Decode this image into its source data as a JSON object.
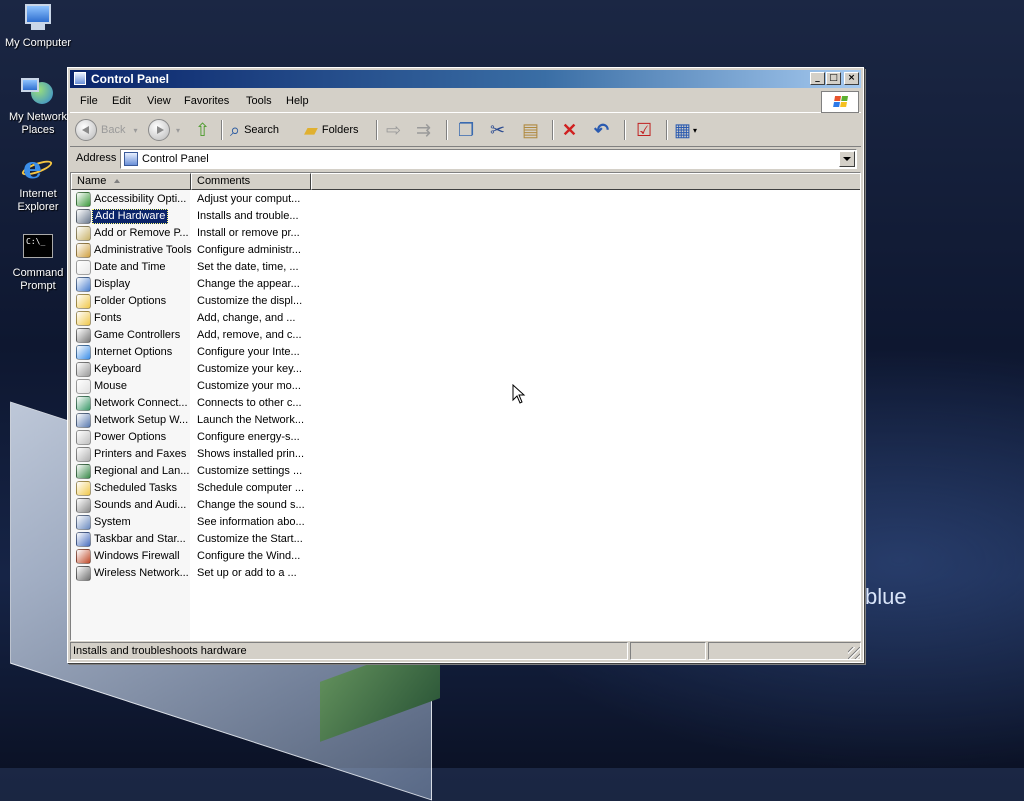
{
  "desktop": {
    "icons": [
      {
        "label": "My Computer"
      },
      {
        "label": "My Network Places"
      },
      {
        "label": "Internet Explorer"
      },
      {
        "label": "Command Prompt"
      }
    ],
    "brand_text": "blue"
  },
  "window": {
    "title": "Control Panel",
    "controls": {
      "minimize": "_",
      "maximize": "□",
      "close": "×"
    },
    "menu": [
      "File",
      "Edit",
      "View",
      "Favorites",
      "Tools",
      "Help"
    ],
    "toolbar": {
      "back_label": "Back",
      "search_label": "Search",
      "folders_label": "Folders"
    },
    "address": {
      "label": "Address",
      "value": "Control Panel"
    },
    "columns": {
      "name": "Name",
      "comments": "Comments"
    },
    "items": [
      {
        "name": "Accessibility Opti...",
        "comment": "Adjust your comput...",
        "icon": "accessibility-icon",
        "color": "#3c9a3c"
      },
      {
        "name": "Add Hardware",
        "comment": "Installs and trouble...",
        "icon": "add-hardware-icon",
        "color": "#6b7a8f"
      },
      {
        "name": "Add or Remove P...",
        "comment": "Install or remove pr...",
        "icon": "add-remove-programs-icon",
        "color": "#c9b36a"
      },
      {
        "name": "Administrative Tools",
        "comment": "Configure administr...",
        "icon": "administrative-tools-icon",
        "color": "#d0a040"
      },
      {
        "name": "Date and Time",
        "comment": "Set the date, time, ...",
        "icon": "clock-icon",
        "color": "#e8e8e8"
      },
      {
        "name": "Display",
        "comment": "Change the appear...",
        "icon": "display-icon",
        "color": "#4a7fcf"
      },
      {
        "name": "Folder Options",
        "comment": "Customize the displ...",
        "icon": "folder-options-icon",
        "color": "#f0c84a"
      },
      {
        "name": "Fonts",
        "comment": "Add, change, and ...",
        "icon": "fonts-folder-icon",
        "color": "#f0c84a"
      },
      {
        "name": "Game Controllers",
        "comment": "Add, remove, and c...",
        "icon": "game-controller-icon",
        "color": "#7a7a7a"
      },
      {
        "name": "Internet Options",
        "comment": "Configure your Inte...",
        "icon": "internet-options-icon",
        "color": "#3b8ee8"
      },
      {
        "name": "Keyboard",
        "comment": "Customize your key...",
        "icon": "keyboard-icon",
        "color": "#9a9a9a"
      },
      {
        "name": "Mouse",
        "comment": "Customize your mo...",
        "icon": "mouse-icon",
        "color": "#e0e0e0"
      },
      {
        "name": "Network Connect...",
        "comment": "Connects to other c...",
        "icon": "network-connections-icon",
        "color": "#3c9a6a"
      },
      {
        "name": "Network Setup W...",
        "comment": "Launch the Network...",
        "icon": "network-setup-icon",
        "color": "#5a7ab0"
      },
      {
        "name": "Power Options",
        "comment": "Configure energy-s...",
        "icon": "power-options-icon",
        "color": "#c0c0c0"
      },
      {
        "name": "Printers and Faxes",
        "comment": "Shows installed prin...",
        "icon": "printer-icon",
        "color": "#b0b0b0"
      },
      {
        "name": "Regional and Lan...",
        "comment": "Customize settings ...",
        "icon": "globe-icon",
        "color": "#3a8a4a"
      },
      {
        "name": "Scheduled Tasks",
        "comment": "Schedule computer ...",
        "icon": "scheduled-tasks-icon",
        "color": "#f0c84a"
      },
      {
        "name": "Sounds and Audi...",
        "comment": "Change the sound s...",
        "icon": "speaker-icon",
        "color": "#8a8a8a"
      },
      {
        "name": "System",
        "comment": "See information abo...",
        "icon": "system-icon",
        "color": "#6a8ac0"
      },
      {
        "name": "Taskbar and Star...",
        "comment": "Customize the Start...",
        "icon": "taskbar-icon",
        "color": "#4a6fc0"
      },
      {
        "name": "Windows Firewall",
        "comment": "Configure the Wind...",
        "icon": "firewall-icon",
        "color": "#c04a2a"
      },
      {
        "name": "Wireless Network...",
        "comment": "Set up or add to a ...",
        "icon": "wireless-network-icon",
        "color": "#707070"
      }
    ],
    "selected_item": "Add Hardware",
    "status_text": "Installs and troubleshoots hardware"
  },
  "colors": {
    "title_bar": "#0a246a",
    "selection": "#0a246a",
    "chrome": "#d4d0c8"
  }
}
